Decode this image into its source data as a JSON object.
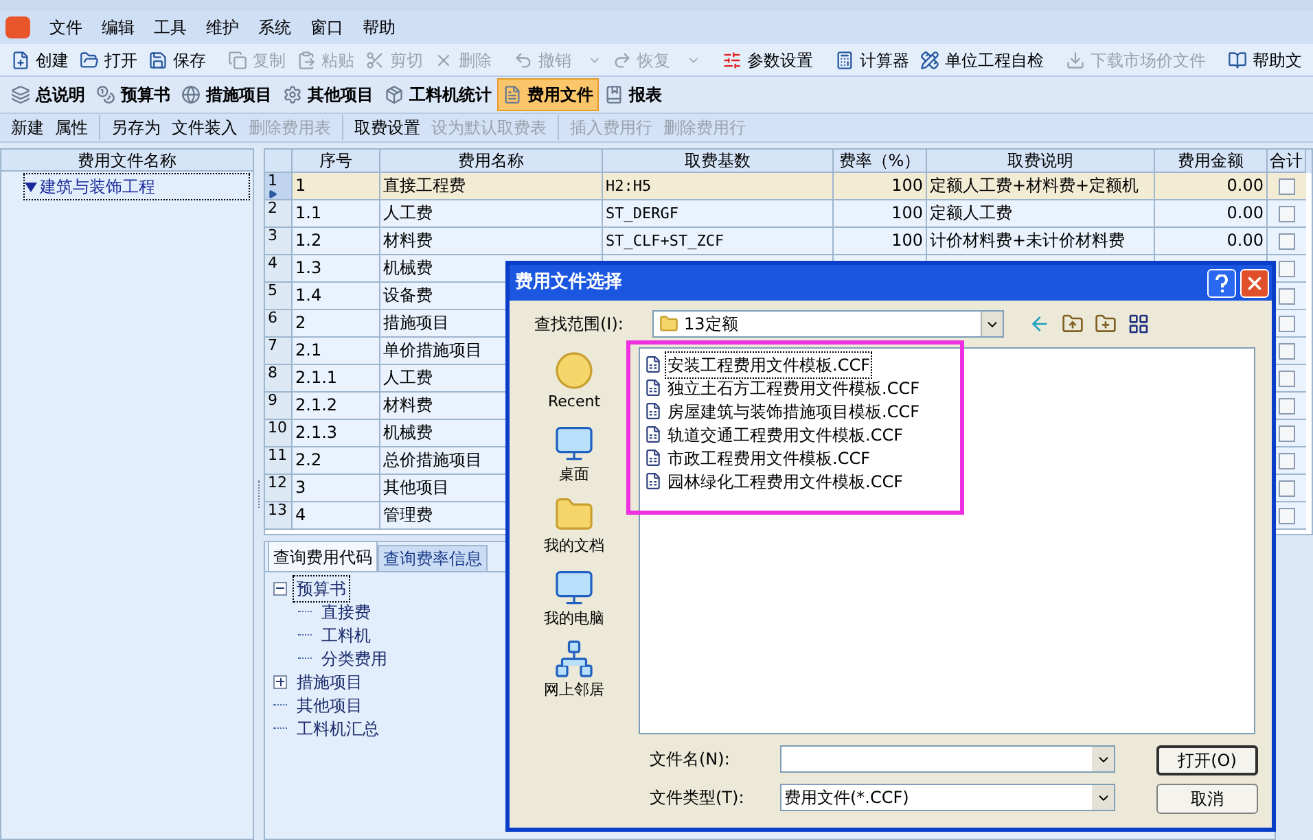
{
  "menu": [
    "文件",
    "编辑",
    "工具",
    "维护",
    "系统",
    "窗口",
    "帮助"
  ],
  "toolbar": [
    [
      {
        "label": "创建",
        "disabled": false
      },
      {
        "label": "打开",
        "disabled": false
      },
      {
        "label": "保存",
        "disabled": false
      }
    ],
    [
      {
        "label": "复制",
        "disabled": true
      },
      {
        "label": "粘贴",
        "disabled": true
      },
      {
        "label": "剪切",
        "disabled": true
      },
      {
        "label": "删除",
        "disabled": true
      }
    ],
    [
      {
        "label": "撤销",
        "disabled": true,
        "dropdown": true
      },
      {
        "label": "恢复",
        "disabled": true,
        "dropdown": true
      }
    ],
    [
      {
        "label": "参数设置",
        "disabled": false
      }
    ],
    [
      {
        "label": "计算器",
        "disabled": false
      },
      {
        "label": "单位工程自检",
        "disabled": false
      }
    ],
    [
      {
        "label": "下载市场价文件",
        "disabled": true
      }
    ],
    [
      {
        "label": "帮助文",
        "disabled": false
      }
    ]
  ],
  "module_tabs": [
    {
      "label": "总说明",
      "selected": false
    },
    {
      "label": "预算书",
      "selected": false
    },
    {
      "label": "措施项目",
      "selected": false
    },
    {
      "label": "其他项目",
      "selected": false
    },
    {
      "label": "工料机统计",
      "selected": false
    },
    {
      "label": "费用文件",
      "selected": true
    },
    {
      "label": "报表",
      "selected": false
    }
  ],
  "sub_toolbar": [
    [
      {
        "label": "新建",
        "disabled": false
      },
      {
        "label": "属性",
        "disabled": false
      }
    ],
    [
      {
        "label": "另存为",
        "disabled": false
      },
      {
        "label": "文件装入",
        "disabled": false
      },
      {
        "label": "删除费用表",
        "disabled": true
      }
    ],
    [
      {
        "label": "取费设置",
        "disabled": false
      },
      {
        "label": "设为默认取费表",
        "disabled": true
      }
    ],
    [
      {
        "label": "插入费用行",
        "disabled": true
      },
      {
        "label": "删除费用行",
        "disabled": true
      }
    ]
  ],
  "file_tree": {
    "header": "费用文件名称",
    "items": [
      {
        "label": "建筑与装饰工程",
        "expanded": true,
        "selected": true
      }
    ]
  },
  "table": {
    "columns": [
      "序号",
      "费用名称",
      "取费基数",
      "费率（%）",
      "取费说明",
      "费用金额",
      "合计"
    ],
    "rows": [
      {
        "number": "1",
        "seq": "1",
        "name": "直接工程费",
        "base": "H2:H5",
        "rate": "100",
        "desc": "定额人工费+材料费+定额机",
        "amount": "0.00",
        "checked": false,
        "selected": true
      },
      {
        "number": "2",
        "seq": "1.1",
        "name": "人工费",
        "base": "ST_DERGF",
        "rate": "100",
        "desc": "定额人工费",
        "amount": "0.00",
        "checked": false,
        "selected": false
      },
      {
        "number": "3",
        "seq": "1.2",
        "name": "材料费",
        "base": "ST_CLF+ST_ZCF",
        "rate": "100",
        "desc": "计价材料费+未计价材料费",
        "amount": "0.00",
        "checked": false,
        "selected": false
      },
      {
        "number": "4",
        "seq": "1.3",
        "name": "机械费",
        "checked": false,
        "selected": false
      },
      {
        "number": "5",
        "seq": "1.4",
        "name": "设备费",
        "checked": false,
        "selected": false
      },
      {
        "number": "6",
        "seq": "2",
        "name": "措施项目",
        "checked": false,
        "selected": false
      },
      {
        "number": "7",
        "seq": "2.1",
        "name": "单价措施项目",
        "checked": false,
        "selected": false
      },
      {
        "number": "8",
        "seq": "2.1.1",
        "name": "人工费",
        "checked": false,
        "selected": false
      },
      {
        "number": "9",
        "seq": "2.1.2",
        "name": "材料费",
        "checked": false,
        "selected": false
      },
      {
        "number": "10",
        "seq": "2.1.3",
        "name": "机械费",
        "checked": false,
        "selected": false
      },
      {
        "number": "11",
        "seq": "2.2",
        "name": "总价措施项目",
        "checked": false,
        "selected": false
      },
      {
        "number": "12",
        "seq": "3",
        "name": "其他项目",
        "checked": false,
        "selected": false
      },
      {
        "number": "13",
        "seq": "4",
        "name": "管理费",
        "checked": false,
        "selected": false
      }
    ]
  },
  "query_tabs": [
    {
      "label": "查询费用代码",
      "selected": true
    },
    {
      "label": "查询费率信息",
      "selected": false
    }
  ],
  "code_tree": [
    {
      "label": "预算书",
      "expanded": true,
      "selected": true,
      "children": [
        {
          "label": "直接费",
          "selected": false
        },
        {
          "label": "工料机",
          "selected": false
        },
        {
          "label": "分类费用",
          "selected": false
        }
      ]
    },
    {
      "label": "措施项目",
      "expanded": false,
      "selected": false
    },
    {
      "label": "其他项目",
      "selected": false
    },
    {
      "label": "工料机汇总",
      "selected": false
    }
  ],
  "dialog": {
    "title": "费用文件选择",
    "look_in_label": "查找范围(I):",
    "look_in_value": "13定额",
    "places": [
      {
        "label": "Recent"
      },
      {
        "label": "桌面"
      },
      {
        "label": "我的文档"
      },
      {
        "label": "我的电脑"
      },
      {
        "label": "网上邻居"
      }
    ],
    "files": [
      {
        "name": "安装工程费用文件模板.CCF",
        "selected": true
      },
      {
        "name": "独立土石方工程费用文件模板.CCF",
        "selected": false
      },
      {
        "name": "房屋建筑与装饰措施项目模板.CCF",
        "selected": false
      },
      {
        "name": "轨道交通工程费用文件模板.CCF",
        "selected": false
      },
      {
        "name": "市政工程费用文件模板.CCF",
        "selected": false
      },
      {
        "name": "园林绿化工程费用文件模板.CCF",
        "selected": false
      }
    ],
    "file_name_label": "文件名(N):",
    "file_type_label": "文件类型(T):",
    "file_type_value": "费用文件(*.CCF)",
    "buttons": [
      "打开(O)",
      "取消"
    ]
  }
}
